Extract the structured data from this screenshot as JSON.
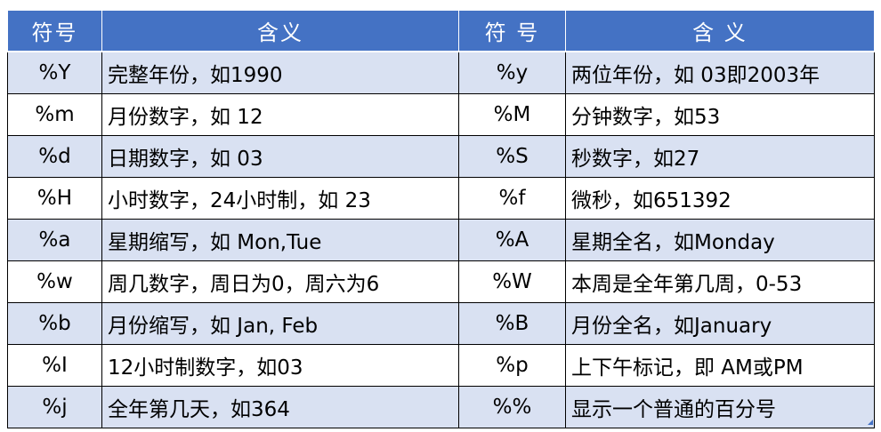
{
  "headers": [
    "符号",
    "含义",
    "符 号",
    "含 义"
  ],
  "rows": [
    {
      "sym1": "%Y",
      "mean1": "完整年份，如1990",
      "sym2": "%y",
      "mean2": "两位年份，如 03即2003年"
    },
    {
      "sym1": "%m",
      "mean1": "月份数字，如 12",
      "sym2": "%M",
      "mean2": "分钟数字，如53"
    },
    {
      "sym1": "%d",
      "mean1": "日期数字，如 03",
      "sym2": "%S",
      "mean2": "秒数字，如27"
    },
    {
      "sym1": "%H",
      "mean1": "小时数字，24小时制，如 23",
      "sym2": "%f",
      "mean2": "微秒，如651392"
    },
    {
      "sym1": "%a",
      "mean1": "星期缩写，如 Mon,Tue",
      "sym2": "%A",
      "mean2": "星期全名，如Monday"
    },
    {
      "sym1": "%w",
      "mean1": "周几数字，周日为0，周六为6",
      "sym2": "%W",
      "mean2": "本周是全年第几周，0-53"
    },
    {
      "sym1": "%b",
      "mean1": "月份缩写，如 Jan, Feb",
      "sym2": "%B",
      "mean2": "月份全名，如January"
    },
    {
      "sym1": "%I",
      "mean1": "12小时制数字，如03",
      "sym2": "%p",
      "mean2": "上下午标记，即 AM或PM"
    },
    {
      "sym1": "%j",
      "mean1": "全年第几天，如364",
      "sym2": "%%",
      "mean2": "显示一个普通的百分号"
    }
  ],
  "colors": {
    "header_bg": "#4472c4",
    "header_text": "#ffffff",
    "band_row_bg": "#d9e1f2",
    "plain_row_bg": "#ffffff"
  }
}
